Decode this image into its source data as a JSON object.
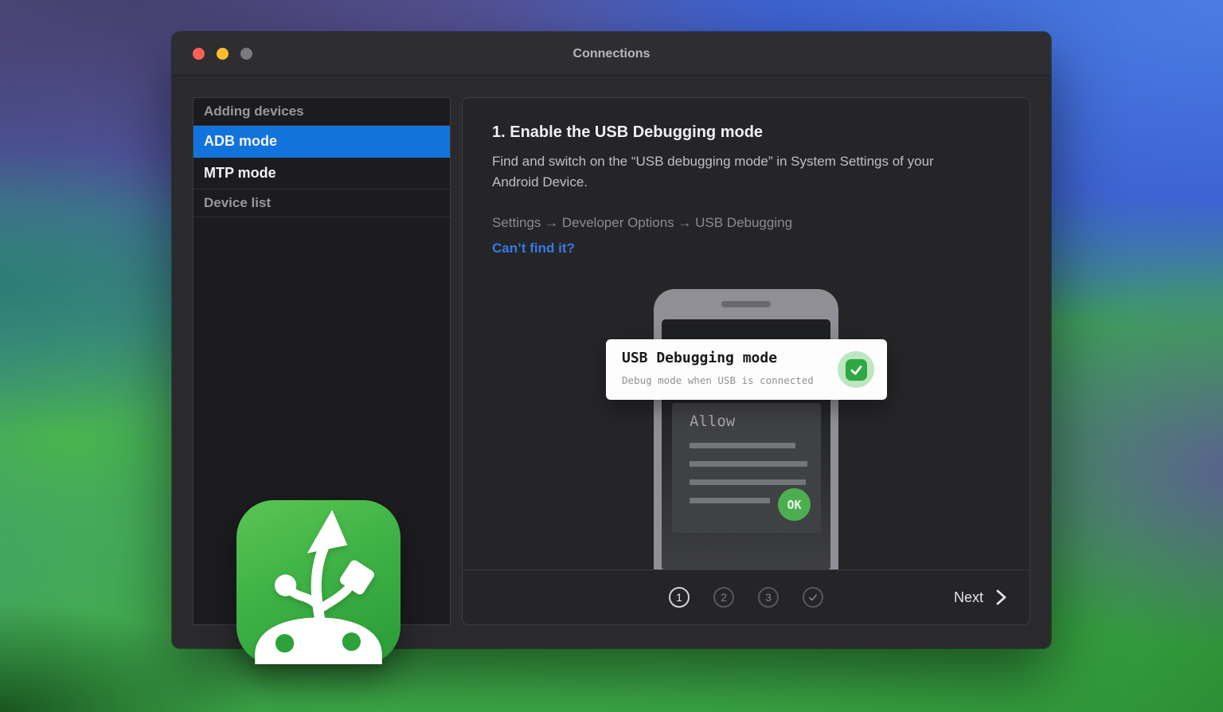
{
  "window": {
    "title": "Connections"
  },
  "sidebar": {
    "items": [
      {
        "label": "Adding devices",
        "type": "section-header"
      },
      {
        "label": "ADB mode",
        "selected": true
      },
      {
        "label": "MTP mode",
        "selected": false
      },
      {
        "label": "Device list",
        "type": "section-header"
      }
    ]
  },
  "main": {
    "step_title": "1. Enable the USB Debugging mode",
    "description": "Find and switch on the “USB debugging mode” in System Settings of your Android Device.",
    "path": "Settings → Developer Options → USB Debugging",
    "link_label": "Can’t find it?",
    "illustration": {
      "card_title": "USB Debugging mode",
      "card_subtitle": "Debug mode when USB is connected",
      "checkbox_checked": true,
      "allow_label": "Allow",
      "ok_label": "OK"
    }
  },
  "footer": {
    "steps": [
      "1",
      "2",
      "3"
    ],
    "current_step": 1,
    "next_label": "Next"
  },
  "colors": {
    "selection_blue": "#1373dc",
    "link_blue": "#3579e6",
    "checkbox_green": "#2fa742",
    "ok_green": "#4cae51",
    "app_icon_green": "#3fae49"
  }
}
